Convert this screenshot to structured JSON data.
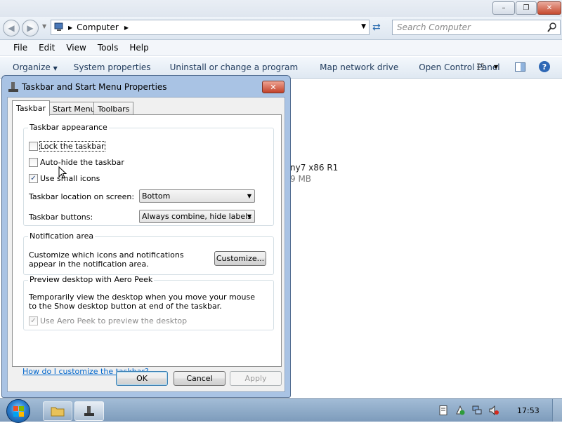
{
  "explorer": {
    "address": {
      "location": "Computer"
    },
    "search": {
      "placeholder": "Search Computer"
    },
    "menu": [
      "File",
      "Edit",
      "View",
      "Tools",
      "Help"
    ],
    "commands": [
      "Organize",
      "System properties",
      "Uninstall or change a program",
      "Map network drive",
      "Open Control Panel"
    ],
    "content": {
      "drive_name_fragment": "ny7 x86 R1",
      "drive_size_fragment": "9 MB"
    }
  },
  "dialog": {
    "title": "Taskbar and Start Menu Properties",
    "tabs": [
      "Taskbar",
      "Start Menu",
      "Toolbars"
    ],
    "active_tab": "Taskbar",
    "appearance": {
      "legend": "Taskbar appearance",
      "lock": {
        "label": "Lock the taskbar",
        "checked": false
      },
      "autohide": {
        "label": "Auto-hide the taskbar",
        "checked": false
      },
      "small_icons": {
        "label": "Use small icons",
        "checked": true
      },
      "location_label": "Taskbar location on screen:",
      "location_value": "Bottom",
      "buttons_label": "Taskbar buttons:",
      "buttons_value": "Always combine, hide labels"
    },
    "notification": {
      "legend": "Notification area",
      "text": "Customize which icons and notifications appear in the notification area.",
      "customize_button": "Customize..."
    },
    "aero_peek": {
      "legend": "Preview desktop with Aero Peek",
      "text": "Temporarily view the desktop when you move your mouse to the Show desktop button at end of the taskbar.",
      "checkbox_label": "Use Aero Peek to preview the desktop",
      "checked": true,
      "disabled": true
    },
    "help_link": "How do I customize the taskbar?",
    "buttons": {
      "ok": "OK",
      "cancel": "Cancel",
      "apply": "Apply"
    }
  },
  "taskbar": {
    "clock": "17:53"
  },
  "colors": {
    "dialog_frame": "#a9c3e4",
    "link": "#0066cc",
    "taskbar": "#8eaccb"
  }
}
